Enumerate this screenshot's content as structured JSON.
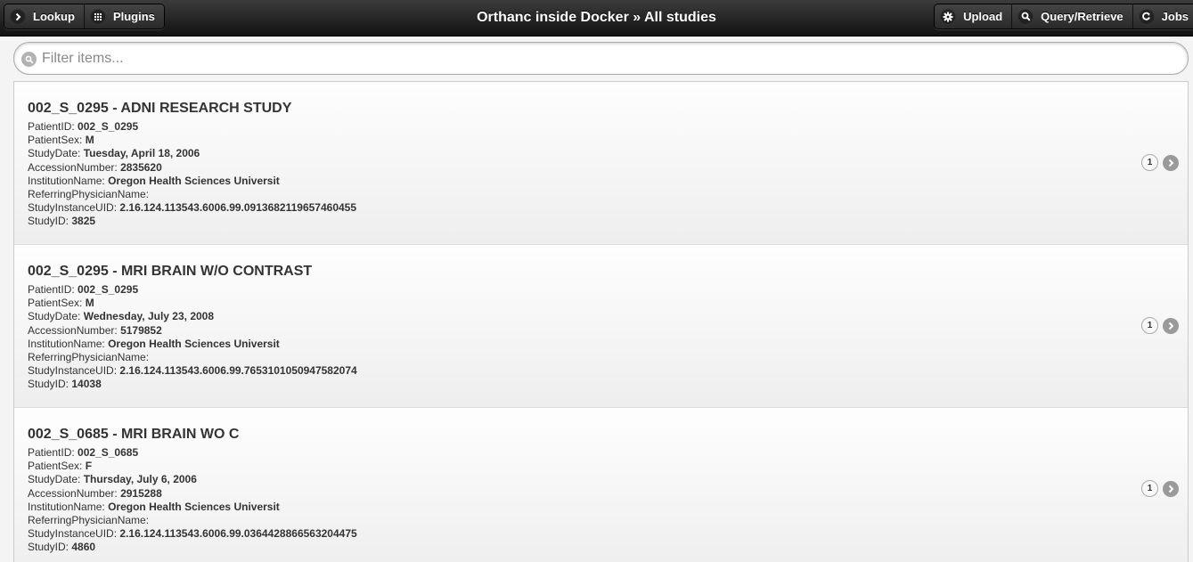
{
  "header": {
    "title": "Orthanc inside Docker » All studies",
    "lookup_label": "Lookup",
    "plugins_label": "Plugins",
    "upload_label": "Upload",
    "query_label": "Query/Retrieve",
    "jobs_label": "Jobs"
  },
  "filter": {
    "placeholder": "Filter items..."
  },
  "labels": {
    "patient_id": "PatientID:",
    "patient_sex": "PatientSex:",
    "study_date": "StudyDate:",
    "accession": "AccessionNumber:",
    "institution": "InstitutionName:",
    "referring": "ReferringPhysicianName:",
    "study_uid": "StudyInstanceUID:",
    "study_id": "StudyID:"
  },
  "studies": [
    {
      "title": "002_S_0295 - ADNI RESEARCH STUDY",
      "patient_id": "002_S_0295",
      "patient_sex": "M",
      "study_date": "Tuesday, April 18, 2006",
      "accession": "2835620",
      "institution": "Oregon Health Sciences Universit",
      "referring": "",
      "study_uid": "2.16.124.113543.6006.99.0913682119657460455",
      "study_id": "3825",
      "count": "1"
    },
    {
      "title": "002_S_0295 - MRI BRAIN W/O CONTRAST",
      "patient_id": "002_S_0295",
      "patient_sex": "M",
      "study_date": "Wednesday, July 23, 2008",
      "accession": "5179852",
      "institution": "Oregon Health Sciences Universit",
      "referring": "",
      "study_uid": "2.16.124.113543.6006.99.7653101050947582074",
      "study_id": "14038",
      "count": "1"
    },
    {
      "title": "002_S_0685 - MRI BRAIN WO C",
      "patient_id": "002_S_0685",
      "patient_sex": "F",
      "study_date": "Thursday, July 6, 2006",
      "accession": "2915288",
      "institution": "Oregon Health Sciences Universit",
      "referring": "",
      "study_uid": "2.16.124.113543.6006.99.0364428866563204475",
      "study_id": "4860",
      "count": "1"
    }
  ]
}
